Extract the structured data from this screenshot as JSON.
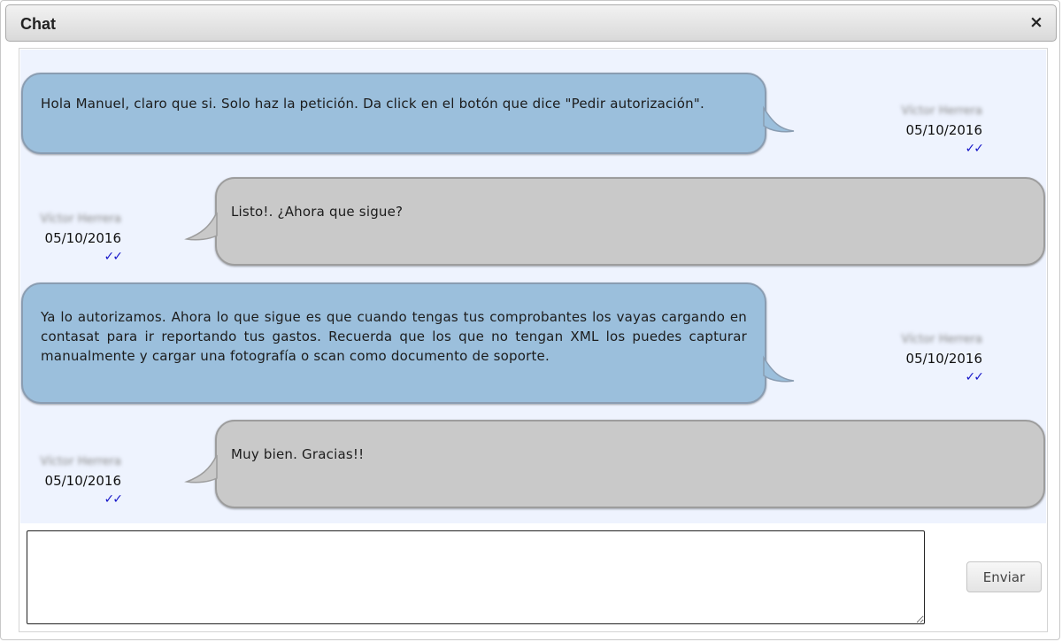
{
  "window": {
    "title": "Chat",
    "close_icon": "×"
  },
  "messages": [
    {
      "side": "left",
      "color": "#9bbfdc",
      "text": "Hola Manuel, claro que si. Solo haz la petición. Da click en el botón que dice \"Pedir autorización\".",
      "sender": "Víctor Herrera",
      "date": "05/10/2016",
      "status": "✓✓"
    },
    {
      "side": "right",
      "color": "#c9c9c9",
      "text": "Listo!. ¿Ahora que sigue?",
      "sender": "Víctor Herrera",
      "date": "05/10/2016",
      "status": "✓✓"
    },
    {
      "side": "left",
      "color": "#9bbfdc",
      "text": "Ya lo autorizamos. Ahora lo que sigue es que cuando tengas tus comprobantes los vayas cargando en contasat para ir reportando tus gastos. Recuerda que los que no tengan XML los puedes capturar manualmente y cargar una fotografía o scan como documento de soporte.",
      "sender": "Víctor Herrera",
      "date": "05/10/2016",
      "status": "✓✓"
    },
    {
      "side": "right",
      "color": "#c9c9c9",
      "text": "Muy bien. Gracias!!",
      "sender": "Víctor Herrera",
      "date": "05/10/2016",
      "status": "✓✓"
    }
  ],
  "composer": {
    "value": "",
    "placeholder": "",
    "send_label": "Enviar"
  },
  "colors": {
    "outgoing_bubble": "#9bbfdc",
    "incoming_bubble": "#c9c9c9",
    "message_area": "#eef3fe",
    "read_ticks": "#1515c8"
  }
}
